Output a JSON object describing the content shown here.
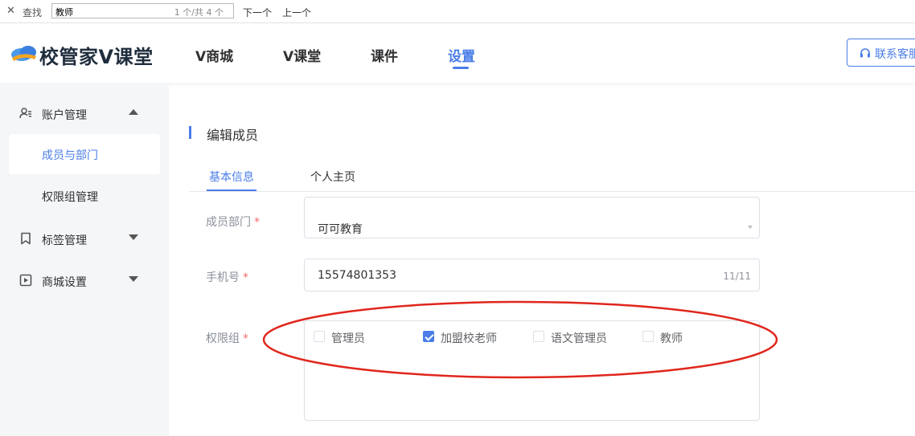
{
  "findbar": {
    "close_glyph": "✕",
    "label": "查找",
    "query": "教师",
    "count": "1 个/共 4 个",
    "next": "下一个",
    "prev": "上一个"
  },
  "header": {
    "logo_text": "校管家V课堂",
    "nav": [
      "V商城",
      "V课堂",
      "课件",
      "设置"
    ],
    "active_nav": "设置",
    "service_button": "联系客服"
  },
  "sidebar": {
    "account": "账户管理",
    "members": "成员与部门",
    "permission_groups": "权限组管理",
    "tags": "标签管理",
    "mall_settings": "商城设置"
  },
  "main": {
    "section_title": "编辑成员",
    "tabs": [
      "基本信息",
      "个人主页"
    ],
    "active_tab": "基本信息",
    "form": {
      "department_label": "成员部门",
      "department_value": "可可教育",
      "phone_label": "手机号",
      "phone_value": "15574801353",
      "phone_counter": "11/11",
      "permission_label": "权限组",
      "required_mark": "*",
      "permission_options": [
        {
          "label": "管理员",
          "checked": false
        },
        {
          "label": "加盟校老师",
          "checked": true
        },
        {
          "label": "语文管理员",
          "checked": false
        },
        {
          "label": "教师",
          "checked": false
        }
      ]
    }
  },
  "colors": {
    "accent": "#4a7de8",
    "required": "#f56c6c",
    "annotation": "#e0261c"
  },
  "icons": {
    "account": "user-gear-icon",
    "tags": "bookmark-icon",
    "mall": "play-square-icon",
    "service": "headset-icon"
  }
}
